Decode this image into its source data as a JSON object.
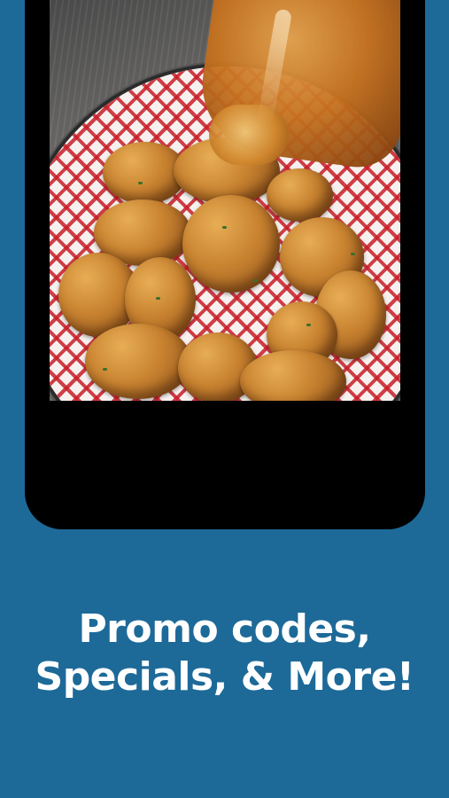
{
  "colors": {
    "background": "#1d6a99",
    "phone_frame": "#000000",
    "caption_text": "#ffffff"
  },
  "screenshot": {
    "image_description": ""
  },
  "caption": {
    "line1": "Promo codes,",
    "line2": "Specials, & More!"
  }
}
